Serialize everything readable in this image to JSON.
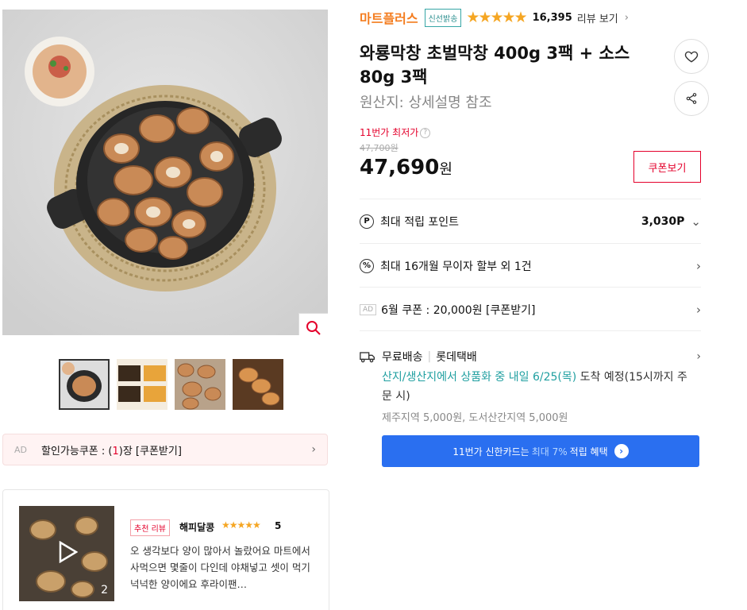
{
  "brand": {
    "name": "마트플러스",
    "badge": "신선밝송"
  },
  "rating": {
    "stars": "★★★★★",
    "review_count": "16,395",
    "review_link": "리뷰 보기"
  },
  "product": {
    "title": "와룡막창 초벌막창 400g 3팩 + 소스 80g 3팩",
    "origin": "원산지:  상세설명 참조"
  },
  "price": {
    "lowest_label": "11번가 최저가",
    "original": "47,700원",
    "current": "47,690",
    "currency": "원",
    "coupon_button": "쿠폰보기"
  },
  "benefits": [
    {
      "icon": "P",
      "label": "최대 적립 포인트",
      "value": "3,030P"
    },
    {
      "icon": "%",
      "label": "최대 16개월 무이자 할부 외 1건",
      "value": ""
    },
    {
      "icon": "AD",
      "label": "6월 쿠폰 : 20,000원 [쿠폰받기]",
      "value": ""
    }
  ],
  "shipping": {
    "type": "무료배송",
    "carrier": "롯데택배",
    "date_prefix": "산지/생산지에서 상품화 중 내일 6/25(목)",
    "date_suffix": " 도착 예정(15시까지 주문 시)",
    "extra": "제주지역 5,000원, 도서산간지역 5,000원"
  },
  "card_banner": {
    "prefix": "11번가 신한카드는",
    "highlight": "최대 7%",
    "suffix": "적립 혜택"
  },
  "coupon_bar": {
    "ad": "AD",
    "prefix": "할인가능쿠폰 : (",
    "count": "1",
    "suffix": ")장 [쿠폰받기]"
  },
  "review": {
    "tag": "추천 리뷰",
    "user": "해피달콩",
    "stars": "★★★★★",
    "score": "5",
    "text": "오 생각보다 양이 많아서 놀랐어요 마트에서 사먹으면 몇줄이 다인데 야채넣고 셋이 먹기 넉넉한 양이에요 후라이팬…",
    "image_count": "2"
  },
  "colors": {
    "brand_orange": "#f47d20",
    "accent_red": "#e4002b",
    "teal": "#1f9fa0",
    "banner_blue": "#2a6ff0"
  }
}
